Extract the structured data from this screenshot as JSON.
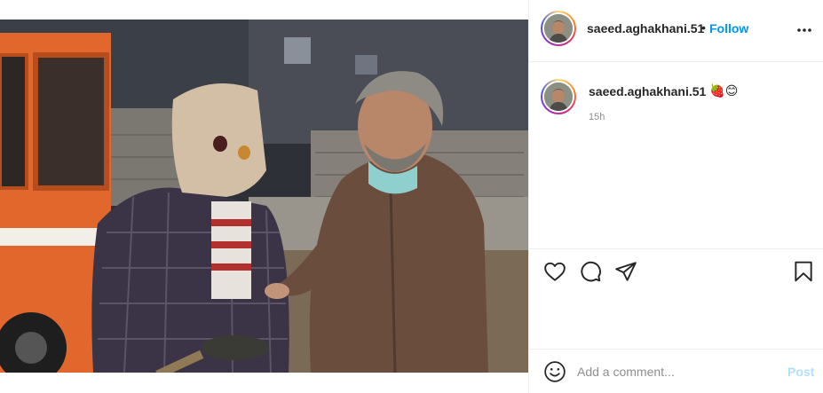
{
  "post": {
    "username": "saeed.aghakhani.51",
    "follow_label": "Follow",
    "separator": "•",
    "caption_emojis": "🍓😊",
    "time_ago": "15h"
  },
  "comment_box": {
    "placeholder": "Add a comment...",
    "post_label": "Post"
  },
  "icons": {
    "more": "more-options-icon",
    "like": "heart-icon",
    "comment": "comment-bubble-icon",
    "share": "paper-plane-icon",
    "save": "bookmark-icon",
    "emoji": "smiley-icon"
  },
  "colors": {
    "accent": "#0095f6",
    "post_disabled": "#b2dffc",
    "muted": "#8e8e8e",
    "border": "#efefef"
  }
}
